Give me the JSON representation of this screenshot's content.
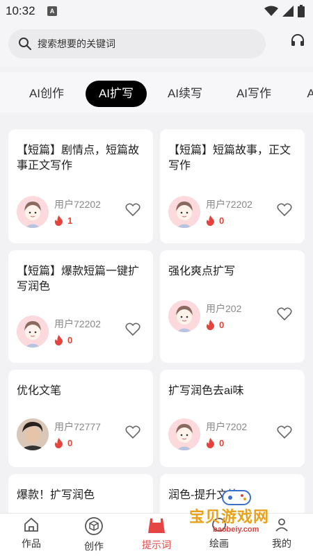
{
  "status": {
    "time": "10:32",
    "badge": "A"
  },
  "search": {
    "placeholder": "搜索想要的关键词"
  },
  "tabs": [
    "AI创作",
    "AI扩写",
    "AI续写",
    "AI写作",
    "A"
  ],
  "cards": [
    {
      "title": "【短篇】剧情点，短篇故事正文写作",
      "user": "用户72202",
      "likes": "1"
    },
    {
      "title": "【短篇】短篇故事，正文写作",
      "user": "用户72202",
      "likes": "0"
    },
    {
      "title": "【短篇】爆款短篇一键扩写润色",
      "user": "用户72202",
      "likes": "0"
    },
    {
      "title": "强化爽点扩写",
      "user": "用户202",
      "likes": "0"
    },
    {
      "title": "优化文笔",
      "user": "用户72777",
      "likes": "0"
    },
    {
      "title": "扩写润色去ai味",
      "user": "用户7202",
      "likes": "0"
    },
    {
      "title": "爆款！扩写润色",
      "user": "",
      "likes": ""
    },
    {
      "title": "润色-提升文笔",
      "user": "",
      "likes": ""
    }
  ],
  "nav": [
    {
      "label": "作品",
      "icon": "home-icon"
    },
    {
      "label": "创作",
      "icon": "cube-icon"
    },
    {
      "label": "提示词",
      "icon": "prompt-icon"
    },
    {
      "label": "绘画",
      "icon": "paint-icon"
    },
    {
      "label": "我的",
      "icon": "profile-icon"
    }
  ],
  "watermark": {
    "text": "宝贝游戏网",
    "url": "baobeiy.com"
  },
  "colors": {
    "accent": "#e64545",
    "active_tab": "#000000",
    "fire": "#e4443b",
    "avatar_bg": "#fbd9dc"
  }
}
